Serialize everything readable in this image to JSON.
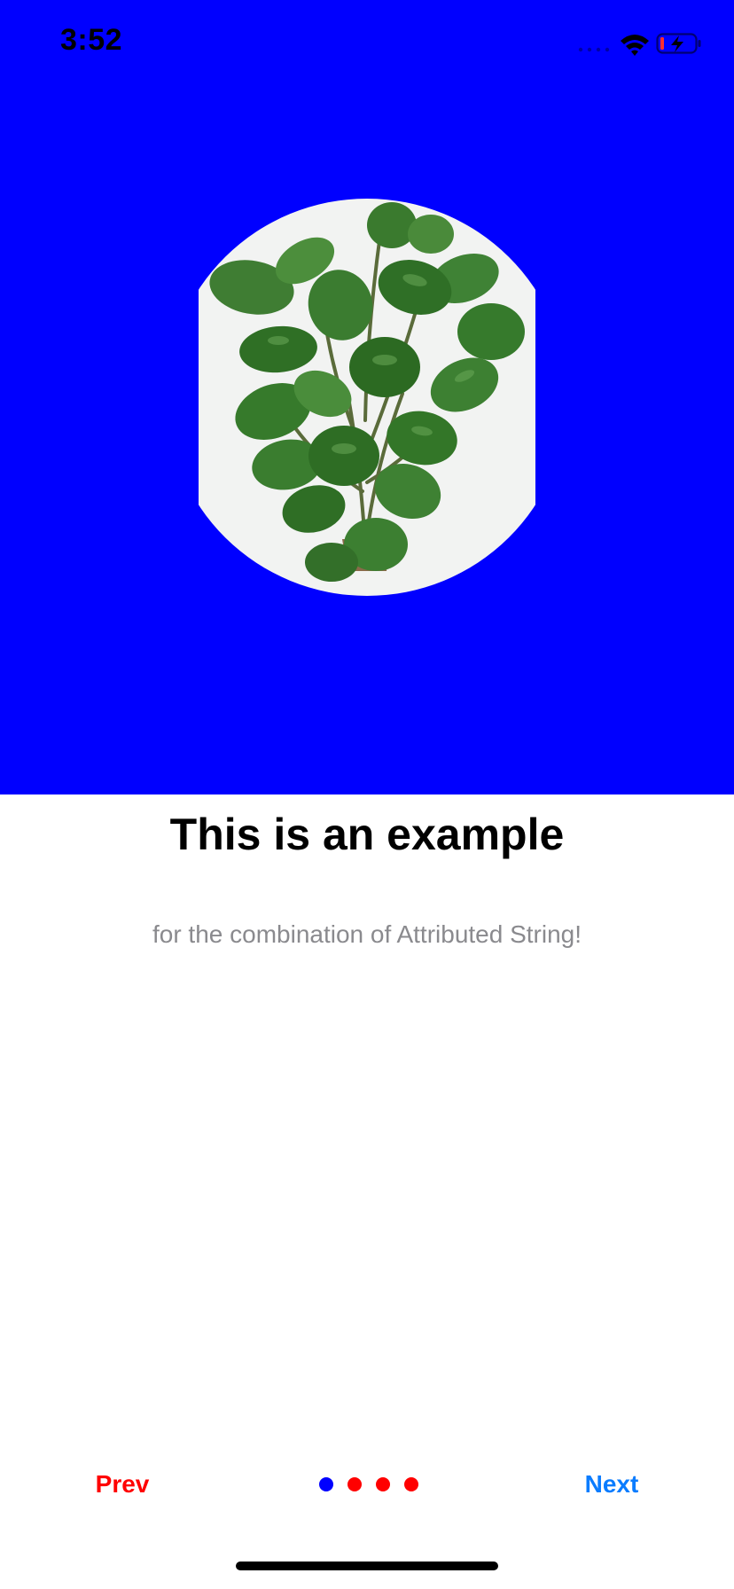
{
  "status_bar": {
    "time": "3:52",
    "signal_icon": "cellular-signal-icon",
    "wifi_icon": "wifi-icon",
    "battery_icon": "battery-charging-icon"
  },
  "hero": {
    "background_color": "#0000ff",
    "image": "plant-image"
  },
  "content": {
    "title": "This is an example",
    "subtitle": "for the combination of Attributed String!"
  },
  "navigation": {
    "prev_label": "Prev",
    "next_label": "Next",
    "prev_color": "#ff0000",
    "next_color": "#0a7cff",
    "page_count": 4,
    "current_page": 1,
    "active_dot_color": "#0000ff",
    "inactive_dot_color": "#ff0000"
  }
}
